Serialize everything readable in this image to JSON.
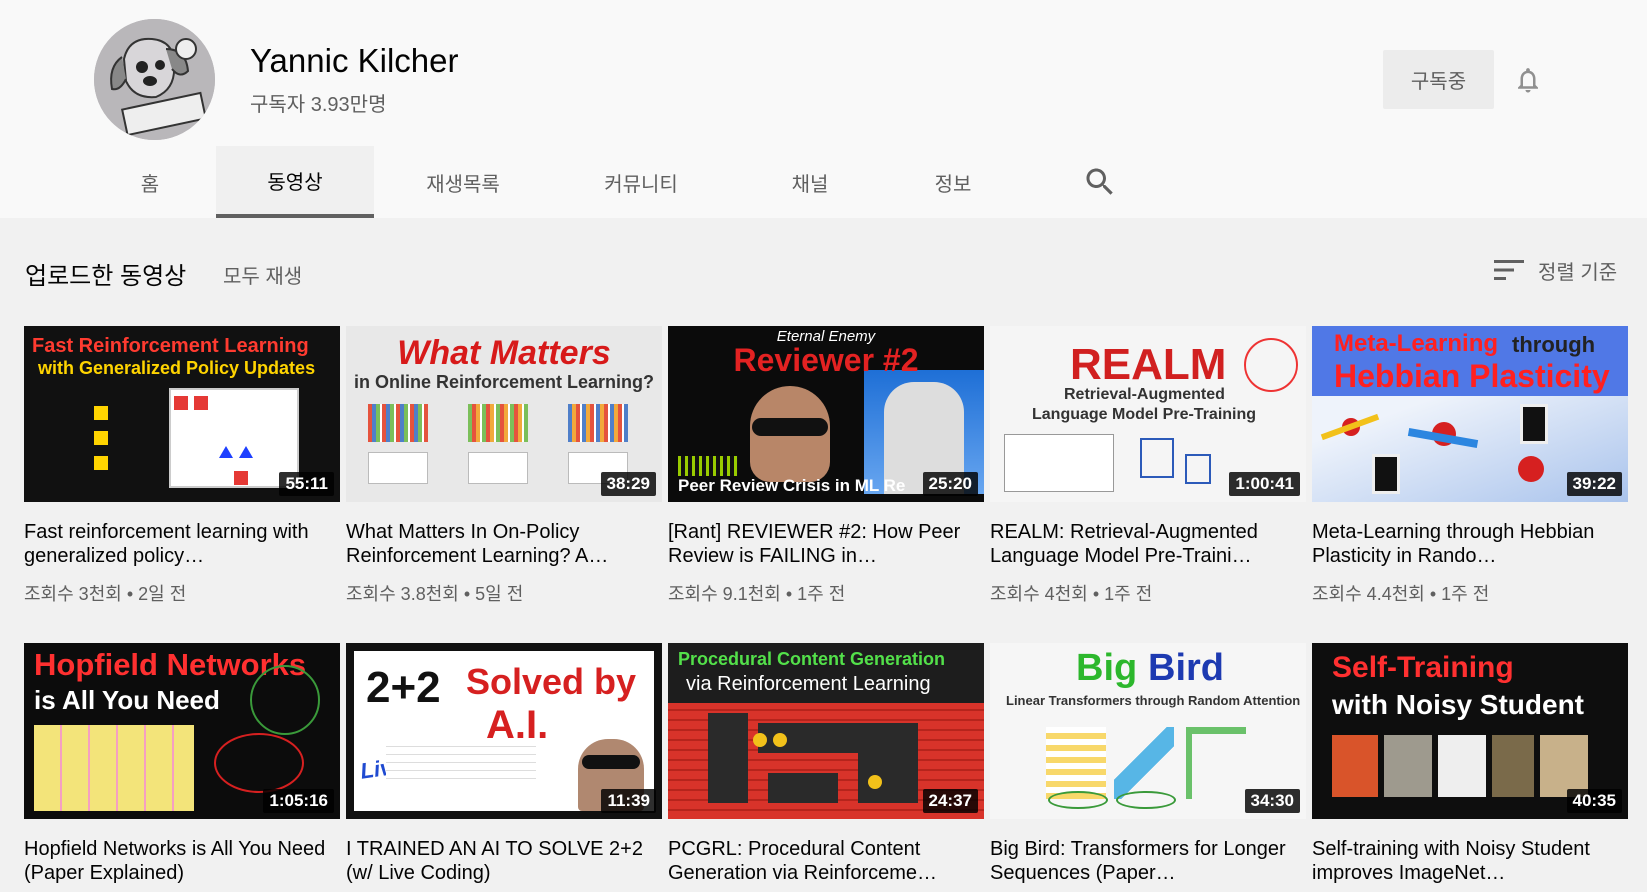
{
  "channel": {
    "name": "Yannic Kilcher",
    "subscribers": "구독자 3.93만명",
    "subscribe_label": "구독중"
  },
  "tabs": [
    {
      "label": "홈"
    },
    {
      "label": "동영상"
    },
    {
      "label": "재생목록"
    },
    {
      "label": "커뮤니티"
    },
    {
      "label": "채널"
    },
    {
      "label": "정보"
    }
  ],
  "section": {
    "title": "업로드한 동영상",
    "play_all": "모두 재생",
    "sort_label": "정렬 기준"
  },
  "videos": [
    {
      "title": "Fast reinforcement learning with generalized policy…",
      "views": "조회수 3천회",
      "age": "2일 전",
      "duration": "55:11",
      "thumb": {
        "line1": "Fast Reinforcement Learning",
        "line2": "with Generalized Policy Updates"
      }
    },
    {
      "title": "What Matters In On-Policy Reinforcement Learning? A…",
      "views": "조회수 3.8천회",
      "age": "5일 전",
      "duration": "38:29",
      "thumb": {
        "line1": "What Matters",
        "line2": "in Online Reinforcement Learning?"
      }
    },
    {
      "title": "[Rant] REVIEWER #2: How Peer Review is FAILING in…",
      "views": "조회수 9.1천회",
      "age": "1주 전",
      "duration": "25:20",
      "thumb": {
        "line0": "Eternal Enemy",
        "line1": "Reviewer #2",
        "line2": "Peer Review Crisis in ML Re"
      }
    },
    {
      "title": "REALM: Retrieval-Augmented Language Model Pre-Traini…",
      "views": "조회수 4천회",
      "age": "1주 전",
      "duration": "1:00:41",
      "thumb": {
        "line1": "REALM",
        "line2": "Retrieval-Augmented",
        "line3": "Language Model Pre-Training"
      }
    },
    {
      "title": "Meta-Learning through Hebbian Plasticity in Rando…",
      "views": "조회수 4.4천회",
      "age": "1주 전",
      "duration": "39:22",
      "thumb": {
        "line1": "Meta-Learning",
        "line1b": "through",
        "line2": "Hebbian Plasticity"
      }
    },
    {
      "title": "Hopfield Networks is All You Need (Paper Explained)",
      "duration": "1:05:16",
      "thumb": {
        "line1": "Hopfield Networks",
        "line2": "is All You Need"
      }
    },
    {
      "title": "I TRAINED AN AI TO SOLVE 2+2 (w/ Live Coding)",
      "duration": "11:39",
      "thumb": {
        "line1": "2+2",
        "line2": "Solved by",
        "line3": "A.I.",
        "line4": "Live Code!"
      }
    },
    {
      "title": "PCGRL: Procedural Content Generation via Reinforceme…",
      "duration": "24:37",
      "thumb": {
        "line1": "Procedural Content Generation",
        "line2": "via Reinforcement Learning"
      }
    },
    {
      "title": "Big Bird: Transformers for Longer Sequences (Paper…",
      "duration": "34:30",
      "thumb": {
        "line1": "Big",
        "line1b": "Bird",
        "line2": "Linear Transformers through Random Attention"
      }
    },
    {
      "title": "Self-training with Noisy Student improves ImageNet…",
      "duration": "40:35",
      "thumb": {
        "line1": "Self-Training",
        "line2": "with Noisy Student"
      }
    }
  ]
}
